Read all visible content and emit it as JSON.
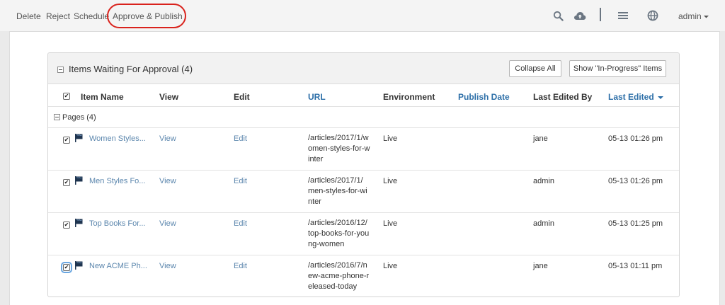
{
  "toolbar": {
    "actions": [
      "Delete",
      "Reject",
      "Schedule",
      "Approve & Publish"
    ],
    "user": "admin"
  },
  "widget": {
    "title": "Items Waiting For Approval (4)",
    "collapse_all": "Collapse All",
    "show_in_progress": "Show \"In-Progress\" Items",
    "columns": [
      "Item Name",
      "View",
      "Edit",
      "URL",
      "Environment",
      "Publish Date",
      "Last Edited By",
      "Last Edited"
    ],
    "group": "Pages (4)",
    "rows": [
      {
        "name": "Women Styles...",
        "view": "View",
        "edit": "Edit",
        "url": [
          "/articles/2017/1/w",
          "omen-styles-for-w",
          "inter"
        ],
        "env": "Live",
        "publish_date": "",
        "editor": "jane",
        "edited": "05-13 01:26 pm",
        "checked": true
      },
      {
        "name": "Men Styles Fo...",
        "view": "View",
        "edit": "Edit",
        "url": [
          "/articles/2017/1/",
          "men-styles-for-wi",
          "nter"
        ],
        "env": "Live",
        "publish_date": "",
        "editor": "admin",
        "edited": "05-13 01:26 pm",
        "checked": true
      },
      {
        "name": "Top Books For...",
        "view": "View",
        "edit": "Edit",
        "url": [
          "/articles/2016/12/",
          "top-books-for-you",
          "ng-women"
        ],
        "env": "Live",
        "publish_date": "",
        "editor": "admin",
        "edited": "05-13 01:25 pm",
        "checked": true
      },
      {
        "name": "New ACME Ph...",
        "view": "View",
        "edit": "Edit",
        "url": [
          "/articles/2016/7/n",
          "ew-acme-phone-r",
          "eleased-today"
        ],
        "env": "Live",
        "publish_date": "",
        "editor": "jane",
        "edited": "05-13 01:11 pm",
        "checked": true
      }
    ]
  },
  "colors": {
    "link": "#2d6fa8",
    "row_link": "#5b86ad",
    "highlight": "#d9221c",
    "icon": "#6b7682"
  },
  "icons": [
    "search-icon",
    "cloud-upload-icon",
    "menu-icon",
    "globe-icon",
    "chevron-down-icon",
    "flag-icon",
    "collapse-icon"
  ]
}
